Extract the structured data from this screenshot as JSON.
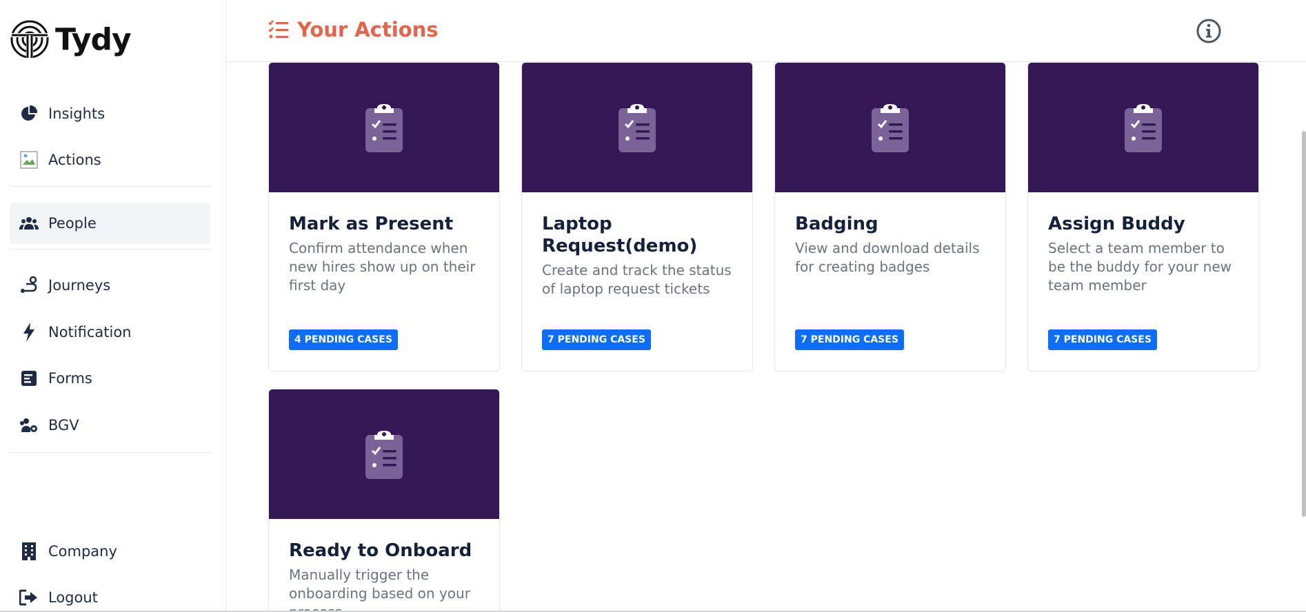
{
  "app": {
    "name": "Tydy"
  },
  "header": {
    "title": "Your Actions"
  },
  "sidebar": {
    "items": [
      {
        "label": "Insights",
        "icon": "pie-chart-icon"
      },
      {
        "label": "Actions",
        "icon": "broken-image-icon"
      },
      {
        "label": "People",
        "icon": "people-icon",
        "active": true
      },
      {
        "label": "Journeys",
        "icon": "route-icon"
      },
      {
        "label": "Notification",
        "icon": "bolt-icon"
      },
      {
        "label": "Forms",
        "icon": "form-icon"
      },
      {
        "label": "BGV",
        "icon": "users-gear-icon"
      },
      {
        "label": "Company",
        "icon": "building-icon"
      },
      {
        "label": "Logout",
        "icon": "logout-icon"
      }
    ]
  },
  "cards": [
    {
      "title": "Mark as Present",
      "description": "Confirm attendance when new hires show up on their first day",
      "badge": "4 PENDING CASES"
    },
    {
      "title": "Laptop Request(demo)",
      "description": "Create and track the status of laptop request tickets",
      "badge": "7 PENDING CASES"
    },
    {
      "title": "Badging",
      "description": "View and download details for creating badges",
      "badge": "7 PENDING CASES"
    },
    {
      "title": "Assign Buddy",
      "description": "Select a team member to be the buddy for your new team member",
      "badge": "7 PENDING CASES"
    },
    {
      "title": "Ready to Onboard",
      "description": "Manually trigger the onboarding based on your process",
      "badge": ""
    }
  ],
  "colors": {
    "accent": "#e8634a",
    "banner": "#341755",
    "badge": "#0d6efd",
    "active_bg": "#f3f4f6"
  }
}
